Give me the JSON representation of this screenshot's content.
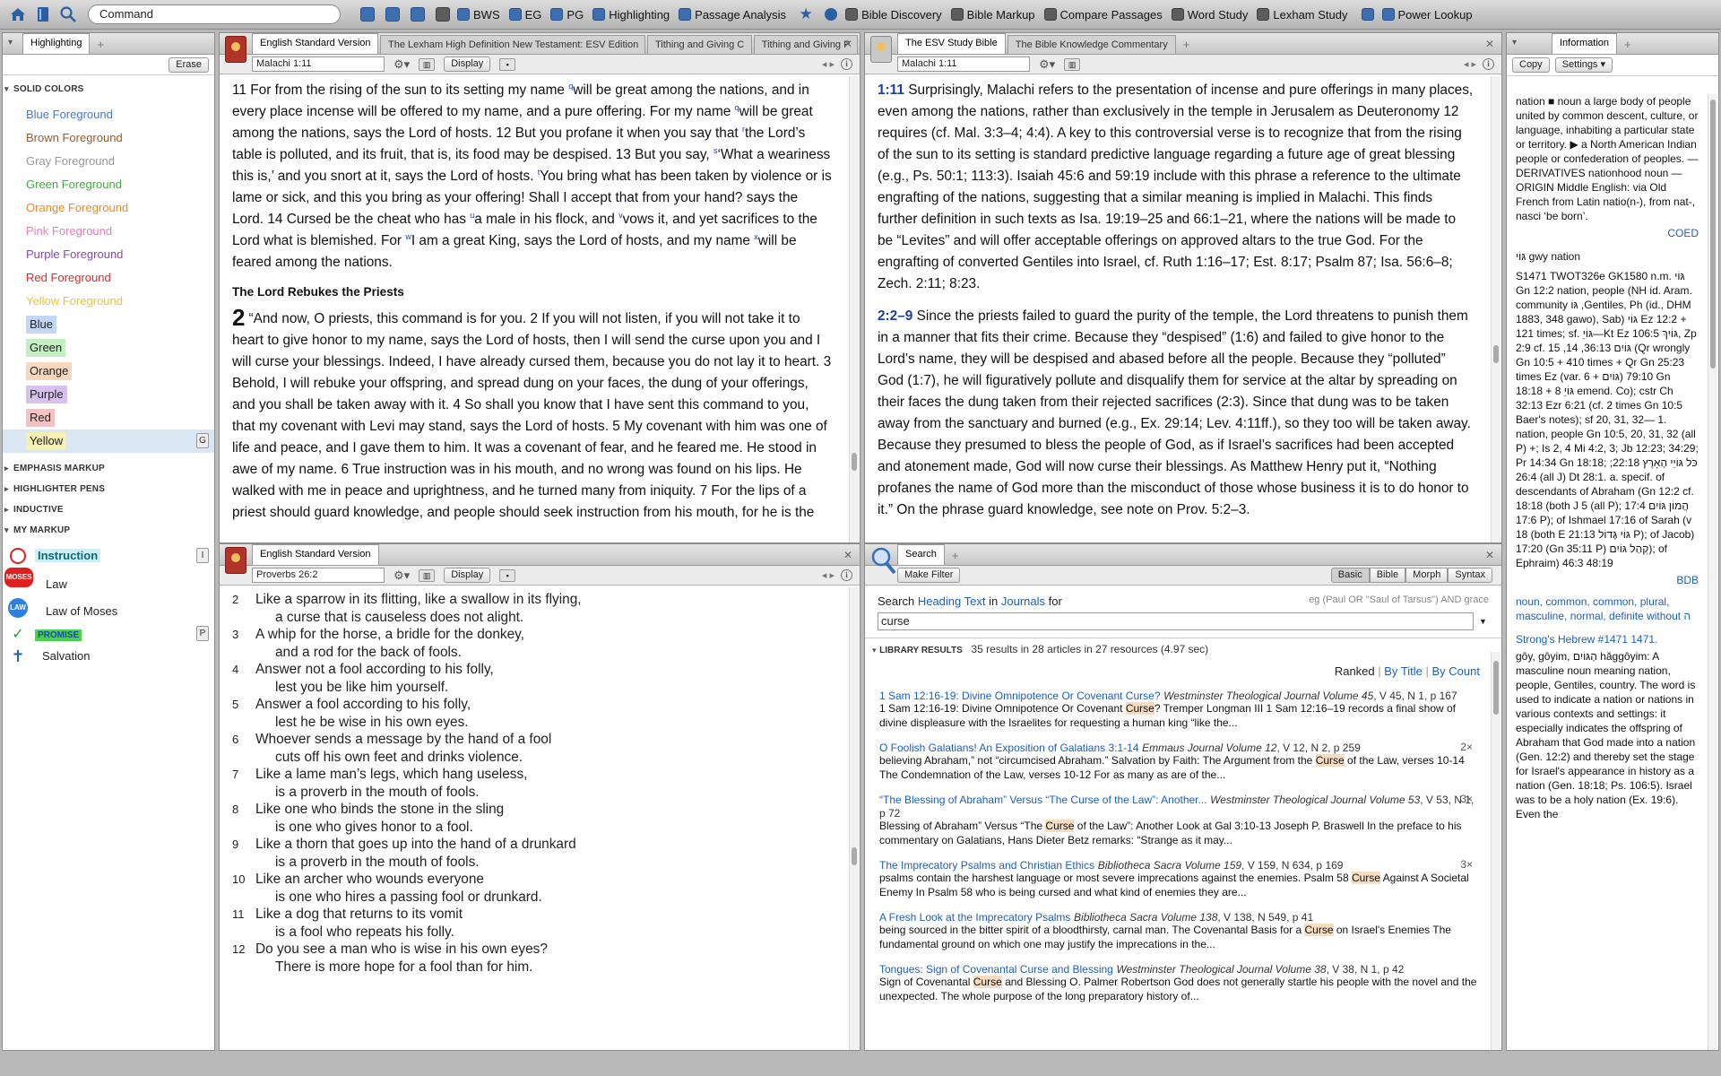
{
  "toolbar": {
    "command_placeholder": "Command",
    "items": [
      {
        "label": "BWS"
      },
      {
        "label": "EG"
      },
      {
        "label": "PG"
      },
      {
        "label": "Highlighting"
      },
      {
        "label": "Passage Analysis"
      },
      {
        "label": "Bible Discovery"
      },
      {
        "label": "Bible Markup"
      },
      {
        "label": "Compare Passages"
      },
      {
        "label": "Word Study"
      },
      {
        "label": "Lexham Study"
      },
      {
        "label": "Power Lookup"
      }
    ]
  },
  "highlighting": {
    "tab": "Highlighting",
    "erase": "Erase",
    "solid_colors_title": "SOLID COLORS",
    "foreground": [
      {
        "label": "Blue Foreground",
        "color": "#3f7bd1"
      },
      {
        "label": "Brown Foreground",
        "color": "#9a5a26"
      },
      {
        "label": "Gray Foreground",
        "color": "#999999"
      },
      {
        "label": "Green Foreground",
        "color": "#3fae3a"
      },
      {
        "label": "Orange Foreground",
        "color": "#ea8a1e"
      },
      {
        "label": "Pink Foreground",
        "color": "#ea79c0"
      },
      {
        "label": "Purple Foreground",
        "color": "#8d45b6"
      },
      {
        "label": "Red Foreground",
        "color": "#d62b2b"
      },
      {
        "label": "Yellow Foreground",
        "color": "#e3c53a"
      }
    ],
    "background": [
      {
        "label": "Blue",
        "color": "#c4d6f5"
      },
      {
        "label": "Green",
        "color": "#c3efc1"
      },
      {
        "label": "Orange",
        "color": "#f8d7bf"
      },
      {
        "label": "Purple",
        "color": "#d7c2ef"
      },
      {
        "label": "Red",
        "color": "#f5c2c2"
      },
      {
        "label": "Yellow",
        "color": "#f6efb4",
        "hotkey": "G"
      }
    ],
    "sections": [
      "EMPHASIS MARKUP",
      "HIGHLIGHTER PENS",
      "INDUCTIVE"
    ],
    "my_markup_title": "MY MARKUP",
    "my_markup": [
      {
        "label": "Instruction",
        "icon": "red-circle-icon",
        "hotkey": "I"
      },
      {
        "label": "Law",
        "icon": "moses-tablet-icon",
        "badge": "MOSES"
      },
      {
        "label": "Law of Moses",
        "icon": "law-badge-icon",
        "badge": "LAW"
      },
      {
        "label": "PROMISE",
        "icon": "check-mark-icon",
        "hotkey": "P"
      },
      {
        "label": "Salvation",
        "icon": "cross-icon"
      }
    ]
  },
  "esv_panel": {
    "tabs": [
      "English Standard Version",
      "The Lexham High Definition New Testament: ESV Edition",
      "Tithing and Giving C",
      "Tithing and Giving P"
    ],
    "reference": "Malachi 1:11",
    "display": "Display",
    "heading": "The Lord Rebukes the Priests",
    "para1": [
      "11 For from the rising of the sun to its setting my name ",
      "will be great among the nations, and in every place incense will be offered to my name, and a pure offering. For my name ",
      "will be great among the nations, says the Lord of hosts. 12 But you profane it when you say that ",
      "the Lord’s table is polluted, and its fruit, that is, its food may be despised. 13 But you say, ",
      "‘What a weariness this is,’ and you snort at it, says the Lord of hosts. ",
      "You bring what has been taken by violence or is lame or sick, and this you bring as your offering! Shall I accept that from your hand? says the Lord. 14 Cursed be the cheat who has ",
      "a male in his flock, and ",
      "vows it, and yet sacrifices to the Lord what is blemished. For ",
      "I am a great King, says the Lord of hosts, and my name ",
      "will be feared among the nations."
    ],
    "chapter": "2",
    "para2": "“And now, O priests, this command is for you. 2 If you will not listen, if you will not take it to heart to give honor to my name, says the Lord of hosts, then I will send the curse upon you and I will curse your blessings. Indeed, I have already cursed them, because you do not lay it to heart. 3 Behold, I will rebuke your offspring, and spread dung on your faces, the dung of your offerings, and you shall be taken away with it. 4 So shall you know that I have sent this command to you, that my covenant with Levi may stand, says the Lord of hosts. 5 My covenant with him was one of life and peace, and I gave them to him. It was a covenant of fear, and he feared me. He stood in awe of my name. 6 True instruction was in his mouth, and no wrong was found on his lips. He walked with me in peace and uprightness, and he turned many from iniquity. 7 For the lips of a priest should guard knowledge, and people should seek instruction from his mouth, for he is the"
  },
  "study_panel": {
    "tabs": [
      "The ESV Study Bible",
      "The Bible Knowledge Commentary"
    ],
    "reference": "Malachi 1:11",
    "note1_ref": "1:11",
    "note1": "Surprisingly, Malachi refers to the presentation of incense and pure offerings in many places, even among the nations, rather than exclusively in the temple in Jerusalem as Deuteronomy 12 requires (cf. Mal. 3:3–4; 4:4). A key to this controversial verse is to recognize that from the rising of the sun to its setting is standard predictive language regarding a future age of great blessing (e.g., Ps. 50:1; 113:3). Isaiah 45:6 and 59:19 include with this phrase a reference to the ultimate engrafting of the nations, suggesting that a similar meaning is implied in Malachi. This finds further definition in such texts as Isa. 19:19–25 and 66:1–21, where the nations will be made to be “Levites” and will offer acceptable offerings on approved altars to the true God. For the engrafting of converted Gentiles into Israel, cf. Ruth 1:16–17; Est. 8:17; Psalm 87; Isa. 56:6–8; Zech. 2:11; 8:23.",
    "note2_ref": "2:2–9",
    "note2": "Since the priests failed to guard the purity of the temple, the Lord threatens to punish them in a manner that fits their crime. Because they “despised” (1:6) and failed to give honor to the Lord’s name, they will be despised and abased before all the people. Because they “polluted” God (1:7), he will figuratively pollute and disqualify them for service at the altar by spreading on their faces the dung taken from their rejected sacrifices (2:3). Since that dung was to be taken away from the sanctuary and burned (e.g., Ex. 29:14; Lev. 4:11ff.), so they too will be taken away. Because they presumed to bless the people of God, as if Israel’s sacrifices had been accepted and atonement made, God will now curse their blessings. As Matthew Henry put it, “Nothing profanes the name of God more than the misconduct of those whose business it is to do honor to it.” On the phrase guard knowledge, see note on Prov. 5:2–3."
  },
  "prov_panel": {
    "tabs": [
      "English Standard Version"
    ],
    "reference": "Proverbs 26:2",
    "display": "Display",
    "lines": [
      {
        "n": "2",
        "a": "Like a sparrow in its flitting, like a swallow in its flying,",
        "b": "a curse that is causeless does not alight."
      },
      {
        "n": "3",
        "a": "A whip for the horse, a bridle for the donkey,",
        "b": "and a rod for the back of fools."
      },
      {
        "n": "4",
        "a": "Answer not a fool according to his folly,",
        "b": "lest you be like him yourself."
      },
      {
        "n": "5",
        "a": "Answer a fool according to his folly,",
        "b": "lest he be wise in his own eyes."
      },
      {
        "n": "6",
        "a": "Whoever sends a message by the hand of a fool",
        "b": "cuts off his own feet and drinks violence."
      },
      {
        "n": "7",
        "a": "Like a lame man’s legs, which hang useless,",
        "b": "is a proverb in the mouth of fools."
      },
      {
        "n": "8",
        "a": "Like one who binds the stone in the sling",
        "b": "is one who gives honor to a fool."
      },
      {
        "n": "9",
        "a": "Like a thorn that goes up into the hand of a drunkard",
        "b": "is a proverb in the mouth of fools."
      },
      {
        "n": "10",
        "a": "Like an archer who wounds everyone",
        "b": "is one who hires a passing fool or drunkard."
      },
      {
        "n": "11",
        "a": "Like a dog that returns to its vomit",
        "b": "is a fool who repeats his folly."
      },
      {
        "n": "12",
        "a": "Do you see a man who is wise in his own eyes?",
        "b": "There is more hope for a fool than for him."
      }
    ]
  },
  "search_panel": {
    "tab": "Search",
    "make_filter": "Make Filter",
    "modes": [
      "Basic",
      "Bible",
      "Morph",
      "Syntax"
    ],
    "search_label": "Search",
    "field_heading": "Heading Text",
    "in_label": "in",
    "field_journals": "Journals",
    "for_label": "for",
    "hint": "eg (Paul OR \"Saul of Tarsus\") AND grace",
    "query": "curse",
    "library_results": "LIBRARY RESULTS",
    "summary": "35 results in 28 articles in 27 resources (4.97 sec)",
    "sort_ranked": "Ranked",
    "sort_title": "By Title",
    "sort_count": "By Count",
    "results": [
      {
        "title": "1 Sam 12:16-19:  Divine Omnipotence Or Covenant Curse?",
        "source": "Westminster Theological Journal Volume 45",
        "meta": ", V 45, N 1, p 167",
        "count": "",
        "pre": "1 Sam 12:16-19: Divine Omnipotence Or Covenant ",
        "hit": "Curse",
        "post": "? Tremper Longman III 1 Sam 12:16–19 records a final show of divine displeasure with the Israelites for requesting a human king “like the..."
      },
      {
        "title": "O Foolish Galatians! An Exposition of Galatians 3:1-14",
        "source": "Emmaus Journal Volume 12",
        "meta": ", V 12, N 2, p 259",
        "count": "2×",
        "pre": "believing Abraham,” not “circumcised Abraham.” Salvation by Faith: The Argument from the ",
        "hit": "Curse",
        "post": " of the Law, verses 10-14 The Condemnation of the Law, verses 10-12 For as many as are of the..."
      },
      {
        "title": "“The Blessing of Abraham” Versus “The Curse of the Law”: Another...",
        "source": "Westminster Theological Journal Volume 53",
        "meta": ", V 53, N 1, p 72",
        "count": "3×",
        "pre": "Blessing of Abraham” Versus “The ",
        "hit": "Curse",
        "post": " of the Law”: Another Look at Gal 3:10-13 Joseph P. Braswell In the preface to his commentary on Galatians, Hans Dieter Betz remarks: “Strange as it may..."
      },
      {
        "title": "The Imprecatory Psalms and Christian Ethics",
        "source": "Bibliotheca Sacra Volume 159",
        "meta": ", V 159, N 634, p 169",
        "count": "3×",
        "pre": "psalms contain the harshest language or most severe imprecations against the enemies. Psalm 58 ",
        "hit": "Curse",
        "post": " Against A Societal Enemy In Psalm 58 who is being cursed and what kind of enemies they are..."
      },
      {
        "title": "A Fresh Look at the Imprecatory Psalms",
        "source": "Bibliotheca Sacra Volume 138",
        "meta": ", V 138, N 549, p 41",
        "count": "",
        "pre": "being sourced in the bitter spirit of a bloodthirsty, carnal man. The Covenantal Basis for a ",
        "hit": "Curse",
        "post": " on Israel's Enemies The fundamental ground on which one may justify the imprecations in the..."
      },
      {
        "title": "Tongues: Sign of Covenantal Curse and Blessing",
        "source": "Westminster Theological Journal Volume 38",
        "meta": ", V 38, N 1, p 42",
        "count": "",
        "pre": "Sign of Covenantal ",
        "hit": "Curse",
        "post": " and Blessing O. Palmer Robertson God does not generally startle his people with the novel and the unexpected. The whole purpose of the long preparatory history of..."
      }
    ]
  },
  "info_panel": {
    "tab": "Information",
    "copy": "Copy",
    "settings": "Settings",
    "definition": "nation ■ noun a large body of people united by common descent, culture, or language, inhabiting a particular state or territory. ▶ a North American Indian people or confederation of peoples. — DERIVATIVES nationhood noun — ORIGIN Middle English: via Old French from Latin natio(n-), from nat-, nasci ‘be born’.",
    "coed": "COED",
    "entry_head": "גּוֹי  gwy  nation",
    "entry_body": "S1471 TWOT326e GK1580 n.m. גּוֹי Gn 12:2 nation, people (NH id. Aram. community גּוֹ ,Gentiles, Ph (id., DHM 1883, 348 gawo), Sab) גּוֹי Ez 12:2 + 121 times; sf. גּוֹיֵ—Kt Ez גּוֹיִךְ 106:5, Zp 2:9 cf. גּוֹיִם 36:13, 14, 15 (Qr wrongly Gn 10:5 + 410 times + Qr Gn 25:23 times Ez (var. 6 + גּוֹיִם) 79:10 Gn 18:18 + 8 גּוֹיֵ emend. Co); cstr Ch 32:13 Ezr 6:21 (cf. 2 times Gn 10:5 Baer's notes); sf 20, 31, 32— 1. nation, people Gn 10:5, 20, 31, 32 (all P) +; Is 2, 4 Mi 4:2, 3; Jb 12:23; 34:29; Pr 14:34 Gn 18:18; כֹּל גּוֹיֵי הָאָרֶץ 22:18; 26:4 (all J) Dt 28:1. a. specif. of descendants of Abraham (Gn 12:2 cf. 18:18 (both J 5 (all P); 17:4 הֲמוֹן גּוֹיִם 17:6 P); of Ishmael 17:16 of Sarah (v 18 (both E 21:13 גּוֹי גָּדוֹל P); of Jacob) 17:20 (Gn 35:11 P) קְהַל גּוֹיִם); of Ephraim) 46:3 48:19",
    "bdb": "BDB",
    "links": "noun, common, common, plural, masculine, normal, definite without ה",
    "strongs_head": "Strong's Hebrew #1471 1471.",
    "strongs_body": "gôy, gôyim, הַגּוֹיִם hăggôyim: A masculine noun meaning nation, people, Gentiles, country. The word is used to indicate a nation or nations in various contexts and settings: it especially indicates the offspring of Abraham that God made into a nation (Gen. 12:2) and thereby set the stage for Israel's appearance in history as a nation (Gen. 18:18; Ps. 106:5). Israel was to be a holy nation (Ex. 19:6). Even the"
  }
}
